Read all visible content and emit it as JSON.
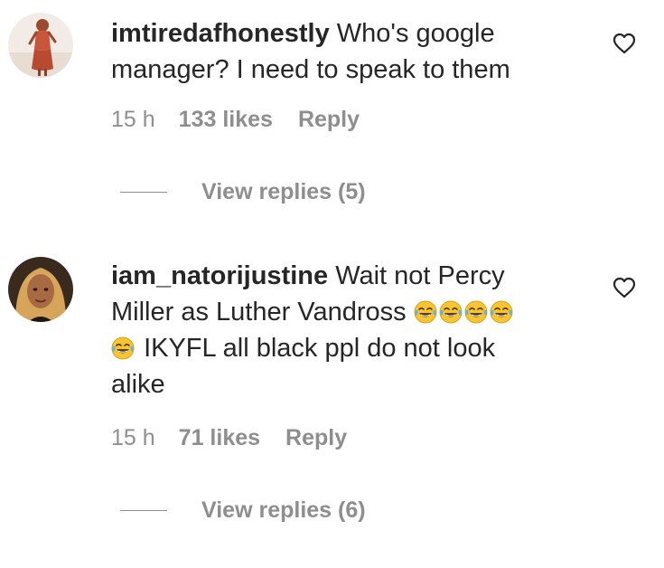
{
  "comments": [
    {
      "username": "imtiredafhonestly",
      "text_lines": [
        "Who's google",
        "manager? I need to speak to them"
      ],
      "time": "15 h",
      "likes": "133 likes",
      "reply_label": "Reply",
      "view_replies": "View replies (5)",
      "avatar_icon": "profile-photo"
    },
    {
      "username": "iam_natorijustine",
      "text_lines": [
        "Wait not Percy",
        "Miller as Luther Vandross",
        "IKYFL all black ppl do not look",
        "alike"
      ],
      "emoji": "face-with-tears-of-joy",
      "emoji_count_line2": 4,
      "emoji_count_line3": 1,
      "time": "15 h",
      "likes": "71 likes",
      "reply_label": "Reply",
      "view_replies": "View replies (6)",
      "avatar_icon": "profile-photo"
    }
  ],
  "colors": {
    "text": "#262626",
    "secondary": "#8e8e8e",
    "emoji_face": "#f7c531"
  }
}
